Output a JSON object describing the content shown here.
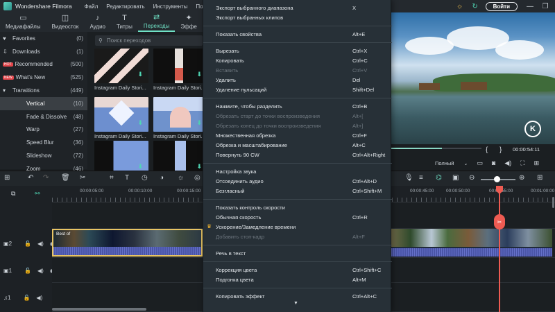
{
  "app": {
    "title": "Wondershare Filmora"
  },
  "menubar": [
    "Файл",
    "Редактировать",
    "Инструменты",
    "Посмотреть"
  ],
  "topright": {
    "login_label": "Войти",
    "icons": [
      "sun-icon",
      "refresh-icon"
    ]
  },
  "tabs": [
    {
      "label": "Медиафайлы",
      "icon": "folder-icon"
    },
    {
      "label": "Видеосток",
      "icon": "stock-icon"
    },
    {
      "label": "Аудио",
      "icon": "music-icon"
    },
    {
      "label": "Титры",
      "icon": "title-icon"
    },
    {
      "label": "Переходы",
      "icon": "transition-icon",
      "active": true
    },
    {
      "label": "Эффе",
      "icon": "effects-icon"
    }
  ],
  "library": [
    {
      "label": "Favorites",
      "count": "(0)",
      "icon": "heart-icon"
    },
    {
      "label": "Downloads",
      "count": "(1)",
      "icon": "download-icon"
    },
    {
      "label": "Recommended",
      "count": "(500)",
      "badge": "HOT"
    },
    {
      "label": "What's New",
      "count": "(525)",
      "badge": "NEW"
    },
    {
      "label": "Transitions",
      "count": "(449)",
      "icon": "caret-down-icon"
    },
    {
      "label": "Vertical",
      "count": "(10)",
      "sub": true,
      "active": true
    },
    {
      "label": "Fade & Dissolve",
      "count": "(48)",
      "sub": true
    },
    {
      "label": "Warp",
      "count": "(27)",
      "sub": true
    },
    {
      "label": "Speed Blur",
      "count": "(36)",
      "sub": true
    },
    {
      "label": "Slideshow",
      "count": "(72)",
      "sub": true
    },
    {
      "label": "Zoom",
      "count": "(46)",
      "sub": true
    }
  ],
  "search": {
    "placeholder": "Поиск переходов"
  },
  "cards": [
    {
      "label": "Instagram Daily Stori..."
    },
    {
      "label": "Instagram Daily Stori..."
    },
    {
      "label": "Instagram Daily Stori..."
    },
    {
      "label": "Instagram Daily Stori..."
    },
    {
      "label": ""
    },
    {
      "label": ""
    }
  ],
  "preview": {
    "timecode": "00:00:54:11",
    "quality": "Полный",
    "playback_fraction": 0.56
  },
  "ruler": {
    "times": [
      "00:00:05:00",
      "00:00:10:00",
      "00:00:15:00"
    ],
    "times_right": [
      "00:00:45:00",
      "00:00:50:00",
      "00:00:55:00",
      "00:01:00:00"
    ]
  },
  "timeline": {
    "clip_title": "Best of",
    "tracks": [
      {
        "name": "2",
        "type": "video"
      },
      {
        "name": "1",
        "type": "video"
      },
      {
        "name": "1",
        "type": "audio"
      }
    ]
  },
  "context_menu": [
    {
      "label": "Экспорт выбранного диапазона",
      "shortcut": "X"
    },
    {
      "label": "Экспорт выбранных клипов",
      "shortcut": ""
    },
    {
      "sep": true
    },
    {
      "label": "Показать свойства",
      "shortcut": "Alt+E"
    },
    {
      "sep": true
    },
    {
      "label": "Вырезать",
      "shortcut": "Ctrl+X"
    },
    {
      "label": "Копировать",
      "shortcut": "Ctrl+C"
    },
    {
      "label": "Вставить",
      "shortcut": "Ctrl+V",
      "disabled": true
    },
    {
      "label": "Удалить",
      "shortcut": "Del"
    },
    {
      "label": "Удаление пульсаций",
      "shortcut": "Shift+Del"
    },
    {
      "sep": true
    },
    {
      "label": "Нажмите, чтобы разделить",
      "shortcut": "Ctrl+B"
    },
    {
      "label": "Обрезать старт до точки воспроизведения",
      "shortcut": "Alt+[",
      "disabled": true
    },
    {
      "label": "Обрезать конец до точки воспроизведения",
      "shortcut": "Alt+]",
      "disabled": true
    },
    {
      "label": "Множественная обрезка",
      "shortcut": "Ctrl+F"
    },
    {
      "label": "Обрезка и масштабирование",
      "shortcut": "Alt+C"
    },
    {
      "label": "Повернуть 90 CW",
      "shortcut": "Ctrl+Alt+Right"
    },
    {
      "sep": true
    },
    {
      "label": "Настройка звука",
      "shortcut": ""
    },
    {
      "label": "Отсоединить аудио",
      "shortcut": "Ctrl+Alt+D"
    },
    {
      "label": "Безгласный",
      "shortcut": "Ctrl+Shift+M"
    },
    {
      "sep": true
    },
    {
      "label": "Показать контроль скорости",
      "shortcut": ""
    },
    {
      "label": "Обычная скорость",
      "shortcut": "Ctrl+R"
    },
    {
      "label": "Ускорение/Замедление времени",
      "shortcut": "",
      "premium": true
    },
    {
      "label": "Добавить стоп-кадр",
      "shortcut": "Alt+F",
      "disabled": true
    },
    {
      "sep": true
    },
    {
      "label": "Речь в текст",
      "shortcut": ""
    },
    {
      "sep": true
    },
    {
      "label": "Коррекция цвета",
      "shortcut": "Ctrl+Shift+C"
    },
    {
      "label": "Подгонка цвета",
      "shortcut": "Alt+M"
    },
    {
      "sep": true
    },
    {
      "label": "Копировать эффект",
      "shortcut": "Ctrl+Alt+C"
    }
  ],
  "colors": {
    "accent": "#70e2c6",
    "playhead": "#ee5b52",
    "clip_border": "#e8c464"
  }
}
